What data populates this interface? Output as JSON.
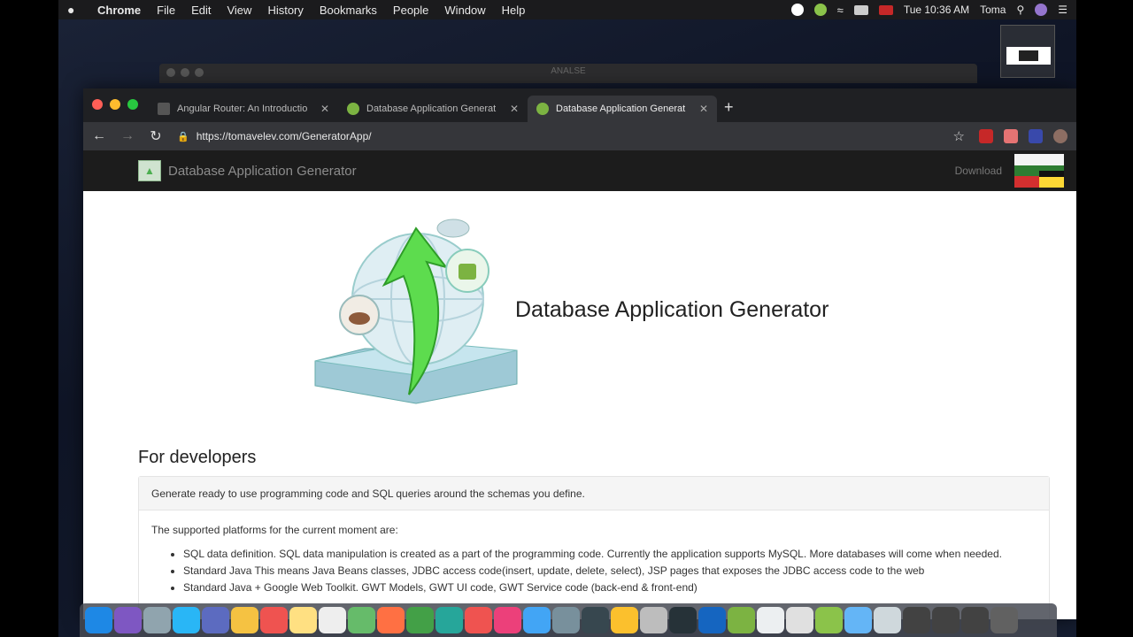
{
  "menubar": {
    "app": "Chrome",
    "items": [
      "File",
      "Edit",
      "View",
      "History",
      "Bookmarks",
      "People",
      "Window",
      "Help"
    ],
    "clock": "Tue 10:36 AM",
    "user": "Toma"
  },
  "background_window": {
    "title": "ANALSE"
  },
  "tabs": [
    {
      "label": "Angular Router: An Introductio",
      "icon": "angular-icon"
    },
    {
      "label": "Database Application Generat",
      "icon": "android-icon"
    },
    {
      "label": "Database Application Generat",
      "icon": "android-icon",
      "active": true
    }
  ],
  "toolbar": {
    "url": "https://tomavelev.com/GeneratorApp/"
  },
  "site": {
    "header_title": "Database Application Generator",
    "download_link": "Download",
    "hero_title": "Database Application Generator",
    "section_heading": "For developers",
    "panel_heading": "Generate ready to use programming code and SQL queries around the schemas you define.",
    "intro": "The supported platforms for the current moment are:",
    "platforms": [
      "SQL data definition. SQL data manipulation is created as a part of the programming code. Currently the application supports MySQL. More databases will come when needed.",
      "Standard Java This means Java Beans classes, JDBC access code(insert, update, delete, select), JSP pages that exposes the JDBC access code to the web",
      "Standard Java + Google Web Toolkit. GWT Models, GWT UI code, GWT Service code (back-end & front-end)"
    ]
  },
  "colors": {
    "accent_green": "#7cb342",
    "tab_bar": "#1f2023",
    "toolbar": "#35363a",
    "site_header": "#1c1c1c"
  },
  "dock": {
    "icons": [
      "finder-icon",
      "siri-icon",
      "launchpad-icon",
      "safari-icon",
      "preview-icon",
      "notes-icon",
      "calendar-icon",
      "stickies-icon",
      "textedit-icon",
      "maps-icon",
      "photos-icon",
      "messages-icon",
      "facetime-icon",
      "news-icon",
      "itunes-icon",
      "appstore-icon",
      "settings-icon",
      "unknown-icon",
      "chrome-icon",
      "chrome-canary-icon",
      "terminal-icon",
      "vscode-icon",
      "android-studio-icon",
      "font-book-icon",
      "script-icon",
      "android-icon",
      "folder-icon",
      "window-icon",
      "window-icon",
      "window-icon",
      "window-icon",
      "trash-icon"
    ]
  }
}
